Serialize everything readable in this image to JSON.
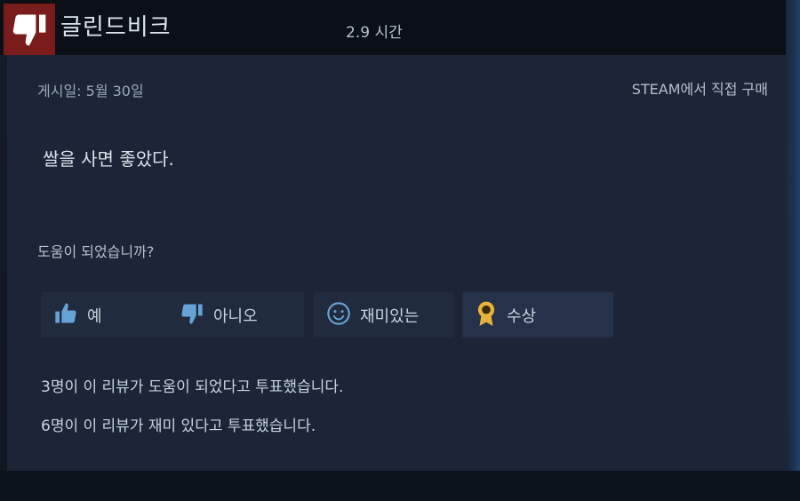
{
  "review": {
    "reviewer_name": "글린드비크",
    "playtime": "2.9 시간",
    "posted_date": "게시일: 5월 30일",
    "purchase_source": "STEAM에서 직접 구매",
    "body_text": "쌀을 사면 좋았다.",
    "recommended": false
  },
  "helpful_prompt": "도움이 되었습니까?",
  "buttons": {
    "yes_label": "예",
    "no_label": "아니오",
    "funny_label": "재미있는",
    "award_label": "수상"
  },
  "vote_summary": {
    "helpful_text": "3명이 이 리뷰가 도움이 되었다고 투표했습니다.",
    "funny_text": "6명이 이 리뷰가 재미 있다고 투표했습니다."
  },
  "icons": {
    "header": "thumbs-down-icon",
    "yes": "thumbs-up-icon",
    "no": "thumbs-down-icon",
    "funny": "smiley-icon",
    "award": "award-ribbon-icon"
  },
  "colors": {
    "not_recommended": "#7a1c1c",
    "thumb_icon_blue": "#67a3d6",
    "award_gold": "#e9b23a"
  }
}
